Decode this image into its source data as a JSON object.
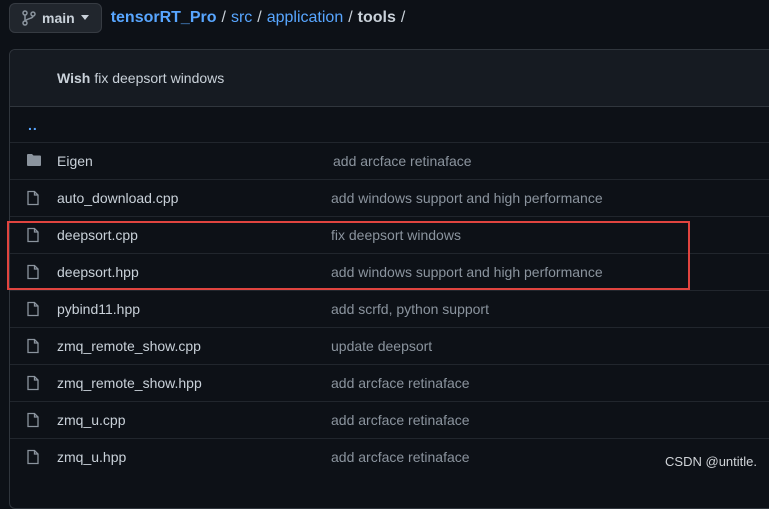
{
  "branch": {
    "label": "main"
  },
  "breadcrumb": {
    "repo": "tensorRT_Pro",
    "path1": "src",
    "path2": "application",
    "current": "tools",
    "sep": "/"
  },
  "commit": {
    "author": "Wish",
    "message": "fix deepsort windows"
  },
  "updir": "..",
  "files": [
    {
      "type": "folder",
      "name": "Eigen",
      "commit": "add arcface retinaface"
    },
    {
      "type": "file",
      "name": "auto_download.cpp",
      "commit": "add windows support and high performance"
    },
    {
      "type": "file",
      "name": "deepsort.cpp",
      "commit": "fix deepsort windows"
    },
    {
      "type": "file",
      "name": "deepsort.hpp",
      "commit": "add windows support and high performance"
    },
    {
      "type": "file",
      "name": "pybind11.hpp",
      "commit": "add scrfd, python support"
    },
    {
      "type": "file",
      "name": "zmq_remote_show.cpp",
      "commit": "update deepsort"
    },
    {
      "type": "file",
      "name": "zmq_remote_show.hpp",
      "commit": "add arcface retinaface"
    },
    {
      "type": "file",
      "name": "zmq_u.cpp",
      "commit": "add arcface retinaface"
    },
    {
      "type": "file",
      "name": "zmq_u.hpp",
      "commit": "add arcface retinaface"
    }
  ],
  "watermark": "CSDN @untitle.",
  "colors": {
    "link": "#58a6ff",
    "highlight": "#e0443f",
    "background": "#0d1117"
  }
}
